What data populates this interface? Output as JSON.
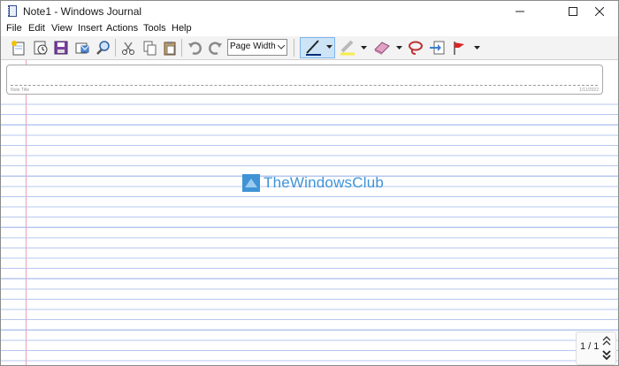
{
  "window": {
    "title": "Note1 - Windows Journal",
    "controls": {
      "minimize": "—",
      "maximize": "☐",
      "close": "✕"
    }
  },
  "menu": [
    {
      "label": "File"
    },
    {
      "label": "Edit"
    },
    {
      "label": "View"
    },
    {
      "label": "Insert"
    },
    {
      "label": "Actions"
    },
    {
      "label": "Tools"
    },
    {
      "label": "Help"
    }
  ],
  "toolbar": {
    "zoom_select": "Page Width",
    "icons": [
      "new-note-icon",
      "open-icon",
      "save-icon",
      "email-icon",
      "find-icon",
      "cut-icon",
      "copy-icon",
      "paste-icon",
      "undo-icon",
      "redo-icon",
      "pen-icon",
      "highlighter-icon",
      "eraser-icon",
      "lasso-select-icon",
      "insert-space-icon",
      "flag-icon"
    ]
  },
  "note": {
    "title_placeholder": "Note Title",
    "date": "1/11/2022"
  },
  "watermark": {
    "text": "TheWindowsClub"
  },
  "pager": {
    "label": "1 / 1"
  },
  "colors": {
    "rule_line": "#b6c7ef",
    "margin_line": "#e6a3b6",
    "watermark": "#3f93d6",
    "selected_tool": "#cde4f7"
  }
}
